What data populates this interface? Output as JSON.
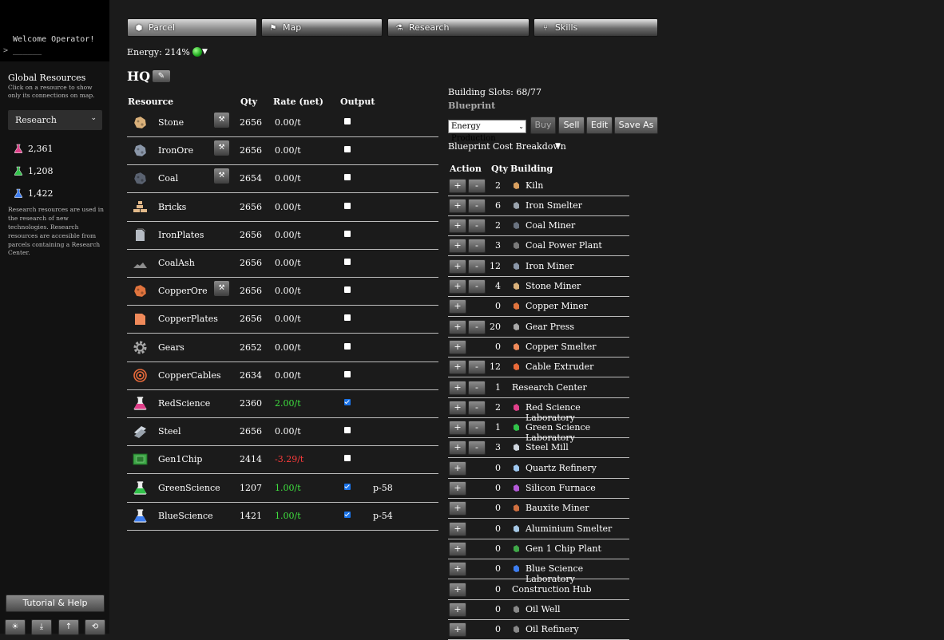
{
  "sidebar": {
    "terminal_line1": "Welcome Operator!",
    "terminal_line2": "> ______",
    "global_title": "Global Resources",
    "global_sub": "Click on a resource to show only its connections on map.",
    "filter_value": "Research",
    "science": [
      {
        "value": "2,361",
        "color": "#e0408a"
      },
      {
        "value": "1,208",
        "color": "#31c24a"
      },
      {
        "value": "1,422",
        "color": "#3d7df0"
      }
    ],
    "note": "Research resources are used in the research of new technologies. Research resources are accesible from parcels containing a Research Center.",
    "tutorial_label": "Tutorial & Help",
    "tools": [
      "sun-icon",
      "download-icon",
      "upload-icon",
      "history-icon"
    ]
  },
  "tabs": [
    {
      "label": "Parcel",
      "icon": "cube-icon",
      "glyph": "⬢"
    },
    {
      "label": "Map",
      "icon": "flag-icon",
      "glyph": "⚑"
    },
    {
      "label": "Research",
      "icon": "flask-icon",
      "glyph": "⚗"
    },
    {
      "label": "Skills",
      "icon": "tree-icon",
      "glyph": "⑂"
    }
  ],
  "energy": {
    "label": "Energy: 214%",
    "status_color": "#1ea81e"
  },
  "parcel": {
    "title": "HQ"
  },
  "resources": {
    "headers": {
      "resource": "Resource",
      "qty": "Qty",
      "rate": "Rate (net)",
      "output": "Output"
    },
    "rows": [
      {
        "name": "Stone",
        "qty": "2656",
        "rate": "0.00/t",
        "mine": true,
        "output": false,
        "link": "",
        "icon": "stone-icon",
        "color": "#d9b07a"
      },
      {
        "name": "IronOre",
        "qty": "2656",
        "rate": "0.00/t",
        "mine": true,
        "output": false,
        "link": "",
        "icon": "iron-ore-icon",
        "color": "#8a96a8"
      },
      {
        "name": "Coal",
        "qty": "2654",
        "rate": "0.00/t",
        "mine": true,
        "output": false,
        "link": "",
        "icon": "coal-icon",
        "color": "#5a6270"
      },
      {
        "name": "Bricks",
        "qty": "2656",
        "rate": "0.00/t",
        "mine": false,
        "output": false,
        "link": "",
        "icon": "bricks-icon",
        "color": "#e2b98a"
      },
      {
        "name": "IronPlates",
        "qty": "2656",
        "rate": "0.00/t",
        "mine": false,
        "output": false,
        "link": "",
        "icon": "iron-plates-icon",
        "color": "#b6bcc4"
      },
      {
        "name": "CoalAsh",
        "qty": "2656",
        "rate": "0.00/t",
        "mine": false,
        "output": false,
        "link": "",
        "icon": "coal-ash-icon",
        "color": "#8d8d8d"
      },
      {
        "name": "CopperOre",
        "qty": "2656",
        "rate": "0.00/t",
        "mine": true,
        "output": false,
        "link": "",
        "icon": "copper-ore-icon",
        "color": "#e0743e"
      },
      {
        "name": "CopperPlates",
        "qty": "2656",
        "rate": "0.00/t",
        "mine": false,
        "output": false,
        "link": "",
        "icon": "copper-plates-icon",
        "color": "#f08a5a"
      },
      {
        "name": "Gears",
        "qty": "2652",
        "rate": "0.00/t",
        "mine": false,
        "output": false,
        "link": "",
        "icon": "gear-icon",
        "color": "#a8a8a8"
      },
      {
        "name": "CopperCables",
        "qty": "2634",
        "rate": "0.00/t",
        "mine": false,
        "output": false,
        "link": "",
        "icon": "copper-cable-icon",
        "color": "#e86a3a"
      },
      {
        "name": "RedScience",
        "qty": "2360",
        "rate": "2.00/t",
        "mine": false,
        "output": true,
        "link": "",
        "icon": "red-science-icon",
        "color": "#e0408a"
      },
      {
        "name": "Steel",
        "qty": "2656",
        "rate": "0.00/t",
        "mine": false,
        "output": false,
        "link": "",
        "icon": "steel-icon",
        "color": "#cfd6de"
      },
      {
        "name": "Gen1Chip",
        "qty": "2414",
        "rate": "-3.29/t",
        "mine": false,
        "output": false,
        "link": "",
        "icon": "chip-icon",
        "color": "#3fa848"
      },
      {
        "name": "GreenScience",
        "qty": "1207",
        "rate": "1.00/t",
        "mine": false,
        "output": true,
        "link": "p-58",
        "icon": "green-science-icon",
        "color": "#31c24a"
      },
      {
        "name": "BlueScience",
        "qty": "1421",
        "rate": "1.00/t",
        "mine": false,
        "output": true,
        "link": "p-54",
        "icon": "blue-science-icon",
        "color": "#3d7df0"
      }
    ]
  },
  "blueprint": {
    "slots": "Building Slots: 68/77",
    "label": "Blueprint",
    "select_value": "Energy Production",
    "buttons": {
      "buy": "Buy",
      "sell": "Sell",
      "edit": "Edit",
      "save_as": "Save As"
    },
    "cost_breakdown": "Blueprint Cost Breakdown",
    "headers": {
      "action": "Action",
      "qty": "Qty",
      "building": "Building"
    },
    "rows": [
      {
        "qty": "2",
        "name": "Kiln",
        "minus": true,
        "icon": "kiln-icon",
        "color": "#d9a060"
      },
      {
        "qty": "6",
        "name": "Iron Smelter",
        "minus": true,
        "icon": "iron-smelter-icon",
        "color": "#9aa3ad"
      },
      {
        "qty": "2",
        "name": "Coal Miner",
        "minus": true,
        "icon": "coal-miner-icon",
        "color": "#6a7380"
      },
      {
        "qty": "3",
        "name": "Coal Power Plant",
        "minus": true,
        "icon": "power-plant-icon",
        "color": "#7a7a7a"
      },
      {
        "qty": "12",
        "name": "Iron Miner",
        "minus": true,
        "icon": "iron-miner-icon",
        "color": "#8a96a8"
      },
      {
        "qty": "4",
        "name": "Stone Miner",
        "minus": true,
        "icon": "stone-miner-icon",
        "color": "#d9b07a"
      },
      {
        "qty": "0",
        "name": "Copper Miner",
        "minus": false,
        "icon": "copper-miner-icon",
        "color": "#e0743e"
      },
      {
        "qty": "20",
        "name": "Gear Press",
        "minus": true,
        "icon": "gear-press-icon",
        "color": "#a8a8a8"
      },
      {
        "qty": "0",
        "name": "Copper Smelter",
        "minus": false,
        "icon": "copper-smelter-icon",
        "color": "#f08a5a"
      },
      {
        "qty": "12",
        "name": "Cable Extruder",
        "minus": true,
        "icon": "cable-extruder-icon",
        "color": "#e86a3a"
      },
      {
        "qty": "1",
        "name": "Research Center",
        "minus": true,
        "icon": "",
        "color": ""
      },
      {
        "qty": "2",
        "name": "Red Science Laboratory",
        "minus": true,
        "icon": "red-lab-icon",
        "color": "#e0408a"
      },
      {
        "qty": "1",
        "name": "Green Science Laboratory",
        "minus": true,
        "icon": "green-lab-icon",
        "color": "#31c24a"
      },
      {
        "qty": "3",
        "name": "Steel Mill",
        "minus": true,
        "icon": "steel-mill-icon",
        "color": "#cfd6de"
      },
      {
        "qty": "0",
        "name": "Quartz Refinery",
        "minus": false,
        "icon": "quartz-refinery-icon",
        "color": "#9ec8f0"
      },
      {
        "qty": "0",
        "name": "Silicon Furnace",
        "minus": false,
        "icon": "silicon-furnace-icon",
        "color": "#b45ad8"
      },
      {
        "qty": "0",
        "name": "Bauxite Miner",
        "minus": false,
        "icon": "bauxite-miner-icon",
        "color": "#d07040"
      },
      {
        "qty": "0",
        "name": "Aluminium Smelter",
        "minus": false,
        "icon": "aluminium-smelter-icon",
        "color": "#a6c8e6"
      },
      {
        "qty": "0",
        "name": "Gen 1 Chip Plant",
        "minus": false,
        "icon": "chip-plant-icon",
        "color": "#3fa848"
      },
      {
        "qty": "0",
        "name": "Blue Science Laboratory",
        "minus": false,
        "icon": "blue-lab-icon",
        "color": "#3d7df0"
      },
      {
        "qty": "0",
        "name": "Construction Hub",
        "minus": false,
        "icon": "",
        "color": ""
      },
      {
        "qty": "0",
        "name": "Oil Well",
        "minus": false,
        "icon": "oil-well-icon",
        "color": "#888"
      },
      {
        "qty": "0",
        "name": "Oil Refinery",
        "minus": false,
        "icon": "oil-refinery-icon",
        "color": "#888"
      }
    ]
  }
}
